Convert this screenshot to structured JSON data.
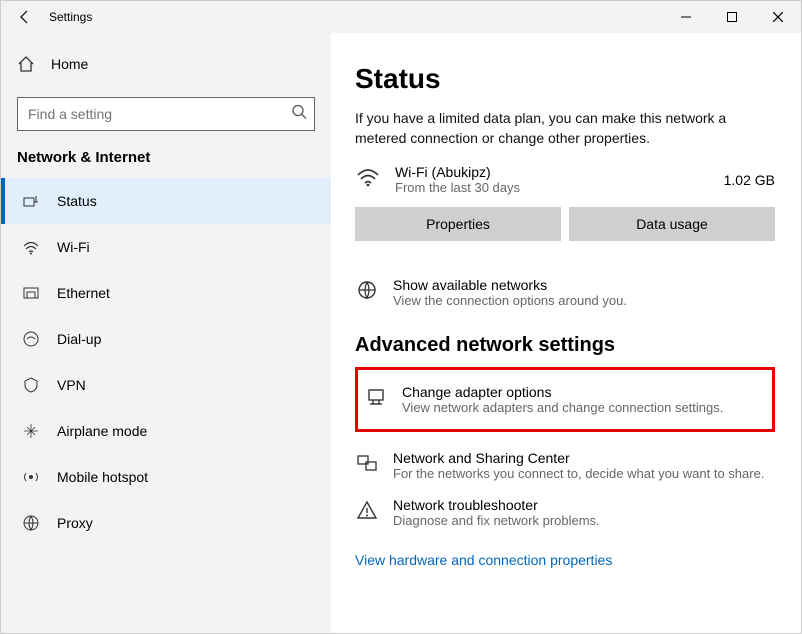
{
  "titlebar": {
    "title": "Settings"
  },
  "home_label": "Home",
  "search": {
    "placeholder": "Find a setting"
  },
  "section": "Network & Internet",
  "nav": [
    {
      "label": "Status",
      "selected": true
    },
    {
      "label": "Wi-Fi"
    },
    {
      "label": "Ethernet"
    },
    {
      "label": "Dial-up"
    },
    {
      "label": "VPN"
    },
    {
      "label": "Airplane mode"
    },
    {
      "label": "Mobile hotspot"
    },
    {
      "label": "Proxy"
    }
  ],
  "main": {
    "heading": "Status",
    "desc": "If you have a limited data plan, you can make this network a metered connection or change other properties.",
    "net": {
      "name": "Wi-Fi (Abukipz)",
      "sub": "From the last 30 days",
      "usage": "1.02 GB"
    },
    "btn_properties": "Properties",
    "btn_data_usage": "Data usage",
    "show_net": {
      "title": "Show available networks",
      "sub": "View the connection options around you."
    },
    "adv_heading": "Advanced network settings",
    "adapter": {
      "title": "Change adapter options",
      "sub": "View network adapters and change connection settings."
    },
    "sharing": {
      "title": "Network and Sharing Center",
      "sub": "For the networks you connect to, decide what you want to share."
    },
    "trouble": {
      "title": "Network troubleshooter",
      "sub": "Diagnose and fix network problems."
    },
    "hw_link": "View hardware and connection properties"
  }
}
